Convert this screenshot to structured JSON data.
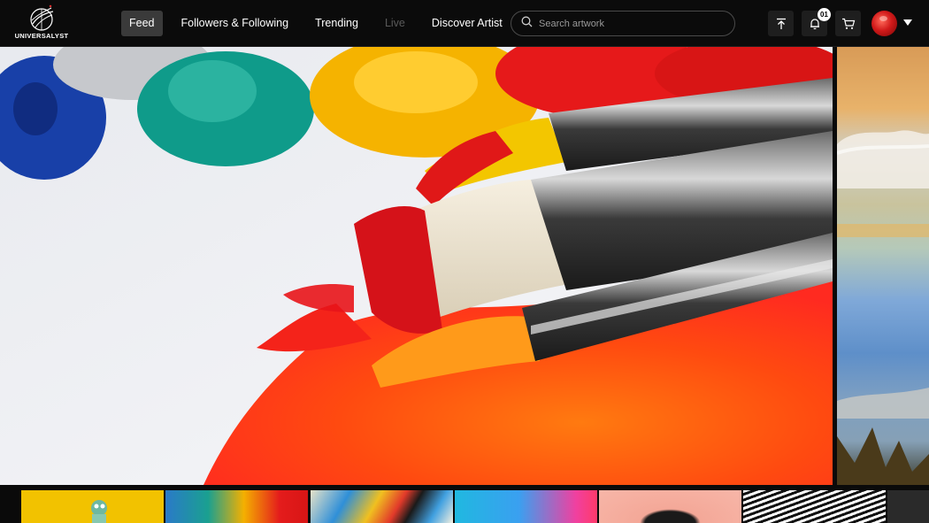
{
  "app": {
    "logo_text": "UNIVERSALYST"
  },
  "nav": {
    "items": [
      {
        "label": "Feed",
        "state": "active"
      },
      {
        "label": "Followers & Following",
        "state": "normal"
      },
      {
        "label": "Trending",
        "state": "normal"
      },
      {
        "label": "Live",
        "state": "disabled"
      },
      {
        "label": "Discover Artist",
        "state": "normal"
      }
    ]
  },
  "search": {
    "placeholder": "Search artwork",
    "icon": "search-icon"
  },
  "actions": {
    "upload_icon": "upload-icon",
    "notifications_icon": "bell-icon",
    "notifications_count": "01",
    "cart_icon": "cart-icon",
    "profile_icon": "avatar",
    "menu_icon": "chevron-down-icon"
  },
  "hero": {
    "subject": "paint brushes with red, yellow and orange paint on canvas"
  },
  "colors": {
    "topbar_bg": "#0b0b0b",
    "active_nav_bg": "#3a3a3a",
    "disabled_nav_text": "#5a5a5a"
  }
}
